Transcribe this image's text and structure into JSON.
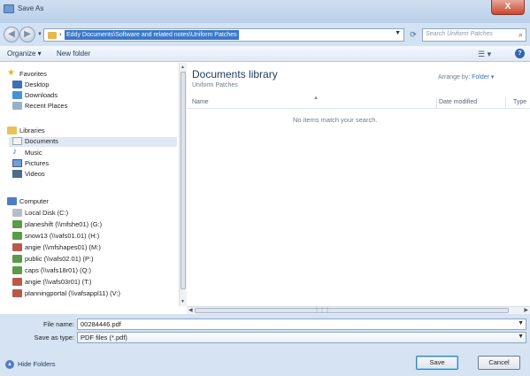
{
  "window": {
    "title": "Save As",
    "close_label": "X"
  },
  "address_bar": {
    "path": "Eddy Documents\\Software and related notes\\Uniform Patches",
    "search_placeholder": "Search Uniform Patches"
  },
  "toolbar": {
    "organize_label": "Organize ▾",
    "new_folder_label": "New folder",
    "views_icon": "views-icon",
    "help_icon": "help-icon"
  },
  "nav_pane": {
    "favorites": {
      "label": "Favorites",
      "items": [
        "Desktop",
        "Downloads",
        "Recent Places"
      ]
    },
    "libraries": {
      "label": "Libraries",
      "items": [
        "Documents",
        "Music",
        "Pictures",
        "Videos"
      ],
      "selected": "Documents"
    },
    "computer": {
      "label": "Computer",
      "items": [
        "Local Disk (C:)",
        "planeshift (\\\\mfshe01) (G:)",
        "snow13 (\\\\vafs01.01) (H:)",
        "angie (\\\\mfshapes01) (M:)",
        "public (\\\\vafs02.01) (P:)",
        "caps (\\\\vafs18r01) (Q:)",
        "angie (\\\\vafs03r01) (T:)",
        "planningportal (\\\\vafsappl11) (V:)"
      ]
    }
  },
  "content": {
    "library_title": "Documents library",
    "library_subtitle": "Uniform Patches",
    "arrange_by_label": "Arrange by:",
    "arrange_by_value": "Folder ▾",
    "columns": [
      "Name",
      "Date modified",
      "Type"
    ],
    "empty_message": "No items match your search."
  },
  "form": {
    "file_name_label": "File name:",
    "file_name_value": "00284446.pdf",
    "save_type_label": "Save as type:",
    "save_type_value": "PDF files (*.pdf)"
  },
  "footer": {
    "hide_folders_label": "Hide Folders",
    "save_label": "Save",
    "cancel_label": "Cancel"
  }
}
